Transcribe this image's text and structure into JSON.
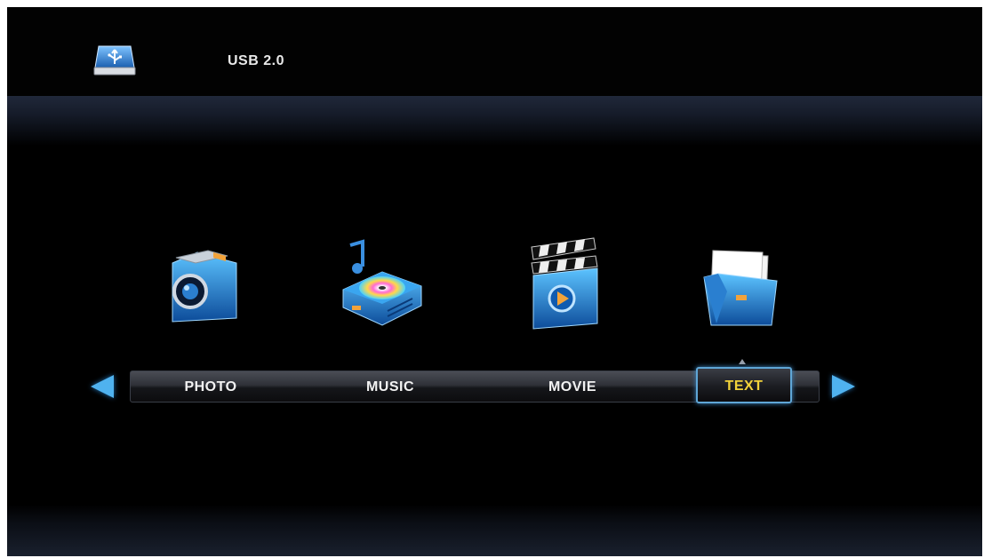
{
  "header": {
    "device_label": "USB 2.0"
  },
  "menu": {
    "items": [
      {
        "label": "PHOTO",
        "icon": "camera-icon"
      },
      {
        "label": "MUSIC",
        "icon": "music-player-icon"
      },
      {
        "label": "MOVIE",
        "icon": "clapperboard-icon"
      },
      {
        "label": "TEXT",
        "icon": "folder-document-icon"
      }
    ],
    "selected": "TEXT"
  },
  "colors": {
    "accent": "#4fb2ef",
    "selected_text": "#f1d23a",
    "menu_text": "#f2f2f2"
  }
}
